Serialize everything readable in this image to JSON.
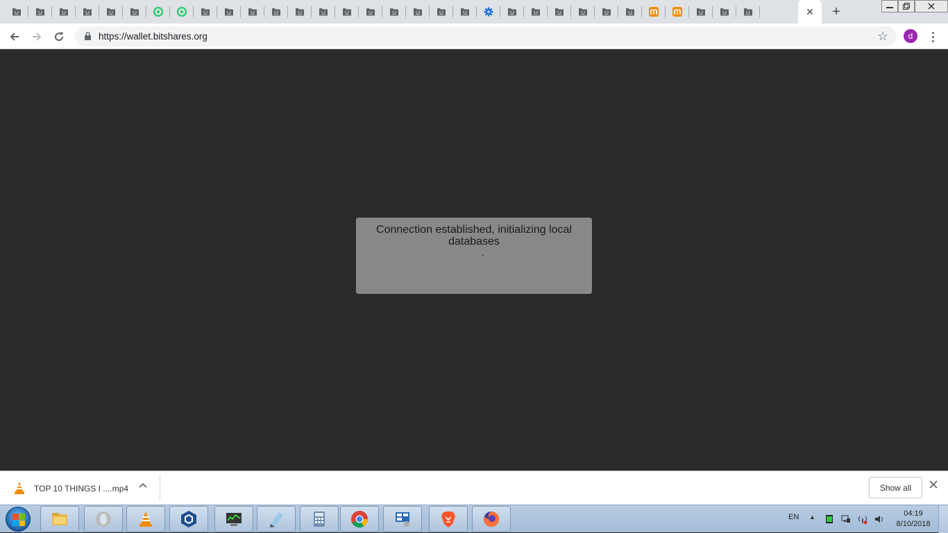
{
  "browser": {
    "tabs": [
      {
        "icon": "sad-face-icon"
      },
      {
        "icon": "sad-face-icon"
      },
      {
        "icon": "sad-face-icon"
      },
      {
        "icon": "sad-face-icon"
      },
      {
        "icon": "sad-face-icon"
      },
      {
        "icon": "sad-face-icon"
      },
      {
        "icon": "green-swirl-icon"
      },
      {
        "icon": "green-swirl-icon"
      },
      {
        "icon": "sad-face-icon"
      },
      {
        "icon": "sad-face-icon"
      },
      {
        "icon": "sad-face-icon"
      },
      {
        "icon": "sad-face-icon"
      },
      {
        "icon": "sad-face-icon"
      },
      {
        "icon": "sad-face-icon"
      },
      {
        "icon": "sad-face-icon"
      },
      {
        "icon": "sad-face-icon"
      },
      {
        "icon": "sad-face-icon"
      },
      {
        "icon": "sad-face-icon"
      },
      {
        "icon": "sad-face-icon"
      },
      {
        "icon": "sad-face-icon"
      },
      {
        "icon": "blue-gear-icon"
      },
      {
        "icon": "sad-face-icon"
      },
      {
        "icon": "sad-face-icon"
      },
      {
        "icon": "sad-face-icon"
      },
      {
        "icon": "sad-face-icon"
      },
      {
        "icon": "sad-face-icon"
      },
      {
        "icon": "sad-face-icon"
      },
      {
        "icon": "orange-m-icon"
      },
      {
        "icon": "orange-m-icon"
      },
      {
        "icon": "sad-face-icon"
      },
      {
        "icon": "sad-face-icon"
      },
      {
        "icon": "sad-face-icon"
      }
    ],
    "active_tab_close": "✕",
    "new_tab": "+",
    "url": "https://wallet.bitshares.org",
    "profile_initial": "d"
  },
  "page": {
    "loading_message": "Connection established, initializing local databases",
    "loading_dots": "."
  },
  "downloads": {
    "file_name": "TOP 10 THINGS I ....mp4",
    "show_all": "Show all"
  },
  "taskbar": {
    "language": "EN",
    "time": "04:19",
    "date": "8/10/2018"
  },
  "colors": {
    "page_background": "#2a2a2a",
    "loading_box": "#888888",
    "profile_avatar": "#9c27b0"
  }
}
